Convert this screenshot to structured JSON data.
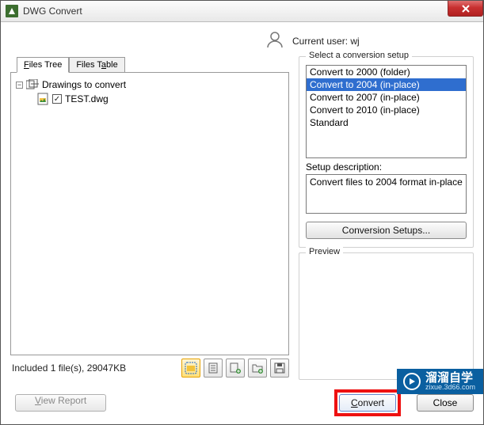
{
  "window": {
    "title": "DWG Convert"
  },
  "user": {
    "label": "Current user:",
    "name": "wj"
  },
  "tabs": {
    "files_tree": "Files Tree",
    "files_table": "Files Table",
    "active": "files_tree"
  },
  "tree": {
    "root_label": "Drawings to convert",
    "items": [
      {
        "name": "TEST.dwg",
        "checked": true
      }
    ]
  },
  "status": {
    "text": "Included 1 file(s), 29047KB"
  },
  "setup": {
    "group_label": "Select a conversion setup",
    "items": [
      "Convert to 2000 (folder)",
      "Convert to 2004 (in-place)",
      "Convert to 2007 (in-place)",
      "Convert to 2010 (in-place)",
      "Standard"
    ],
    "selected_index": 1,
    "description_label": "Setup description:",
    "description": "Convert files to 2004 format in-place",
    "setups_button": "Conversion Setups..."
  },
  "preview": {
    "label": "Preview"
  },
  "buttons": {
    "view_report": "View Report",
    "convert": "Convert",
    "close": "Close"
  },
  "iconbar": {
    "icons": [
      "open-folder",
      "clipboard",
      "add-file",
      "add-folder",
      "save"
    ]
  },
  "watermark": {
    "big": "溜溜自学",
    "small": "zixue.3d66.com"
  }
}
